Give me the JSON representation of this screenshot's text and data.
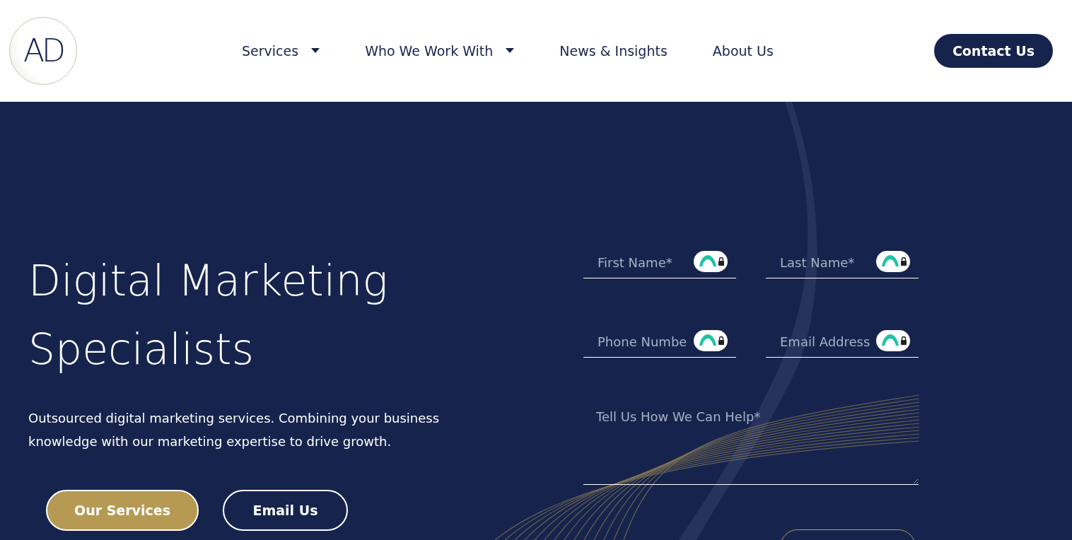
{
  "logo": {
    "text": "AD"
  },
  "nav": {
    "items": [
      {
        "label": "Services",
        "dropdown": true
      },
      {
        "label": "Who We Work With",
        "dropdown": true
      },
      {
        "label": "News & Insights",
        "dropdown": false
      },
      {
        "label": "About Us",
        "dropdown": false
      }
    ],
    "cta": "Contact Us"
  },
  "hero": {
    "title_lines": [
      "Digital Marketing",
      "Specialists"
    ],
    "text": "Outsourced digital marketing services. Combining your business knowledge with our marketing expertise to drive growth.",
    "buttons": [
      {
        "label": "Our Services",
        "kind": "filled"
      },
      {
        "label": "Email Us",
        "kind": "outline"
      }
    ]
  },
  "form": {
    "fields": [
      {
        "placeholder": "First Name*",
        "kind": "input"
      },
      {
        "placeholder": "Last Name*",
        "kind": "input"
      },
      {
        "placeholder": "Phone Numbe",
        "kind": "input"
      },
      {
        "placeholder": "Email Address",
        "kind": "input"
      },
      {
        "placeholder": "Tell Us How We Can Help*",
        "kind": "textarea"
      }
    ]
  }
}
